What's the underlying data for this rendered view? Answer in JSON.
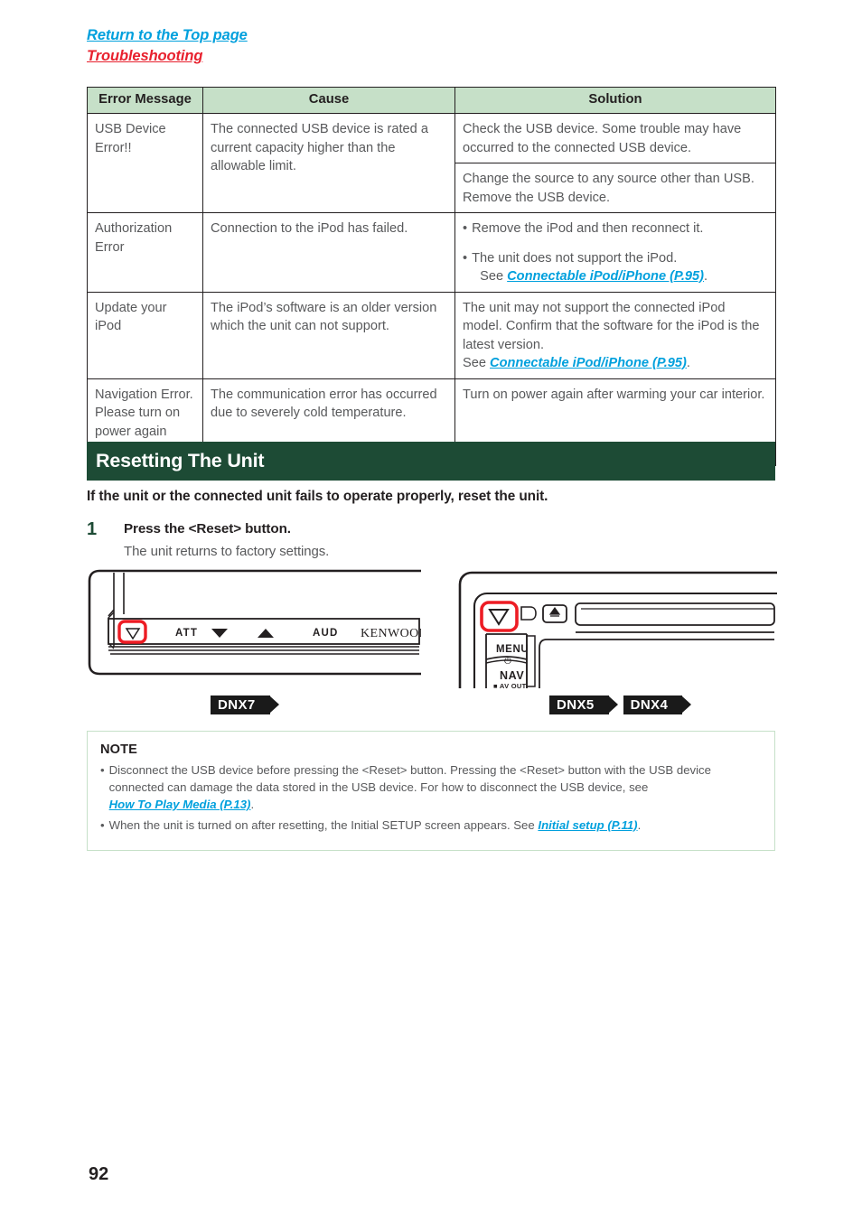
{
  "header": {
    "return_link": "Return to the Top page",
    "breadcrumb_link": "Troubleshooting"
  },
  "table": {
    "columns": [
      "Error Message",
      "Cause",
      "Solution"
    ],
    "rows": [
      {
        "message": "USB Device Error!!",
        "cause": "The connected USB device is rated a current capacity higher than the allowable limit.",
        "solutions": [
          "Check the USB device. Some trouble may have occurred to the connected USB device.",
          "Change the source to any source other than USB. Remove the USB device."
        ]
      },
      {
        "message": "Authorization Error",
        "cause": "Connection to the iPod has failed.",
        "bullets": [
          {
            "text": "Remove the iPod and then reconnect it."
          },
          {
            "text": "The unit does not support the iPod.",
            "see_prefix": "See ",
            "link": "Connectable iPod/iPhone (P.95)",
            "suffix": "."
          }
        ]
      },
      {
        "message": "Update your iPod",
        "cause": "The iPod’s software is an older version which the unit can not support.",
        "solution_text": "The unit may not support the connected iPod model. Confirm that the software for the iPod is the latest version.",
        "see_prefix": "See ",
        "link": "Connectable iPod/iPhone (P.95)",
        "suffix": "."
      },
      {
        "message": "Navigation Error. Please turn on power again later.",
        "cause": "The communication error has occurred due to severely cold temperature.",
        "solution_text": "Turn on power again after warming your car interior."
      }
    ]
  },
  "section": {
    "title": "Resetting The Unit",
    "lead": "If the unit or the connected unit fails to operate properly, reset the unit.",
    "step_number": "1",
    "step_title": "Press the <Reset> button.",
    "step_sub": "The unit returns to factory settings."
  },
  "illustrations": {
    "left": {
      "labels": [
        "ATT",
        "AUD",
        "KENWOOD"
      ],
      "badges": [
        "DNX7"
      ]
    },
    "right": {
      "labels": [
        "MENU",
        "NAV",
        "AV OUT"
      ],
      "badges": [
        "DNX5",
        "DNX4"
      ]
    }
  },
  "note": {
    "title": "NOTE",
    "items": [
      {
        "text_before": "Disconnect the USB device before pressing the <Reset> button. Pressing the <Reset> button with the USB device connected can damage the data stored in the USB device. For how to disconnect the USB device, see ",
        "link": "How To Play Media (P.13)",
        "text_after": "."
      },
      {
        "text_before": "When the unit is turned on after resetting, the Initial SETUP screen appears. See ",
        "link": "Initial setup (P.11)",
        "text_after": "."
      }
    ]
  },
  "page_number": "92",
  "colors": {
    "link_blue": "#00a0dd",
    "link_red": "#e8212e",
    "header_green": "#c6e0c8",
    "section_green": "#1d4b35",
    "highlight_red": "#ed1c24"
  }
}
